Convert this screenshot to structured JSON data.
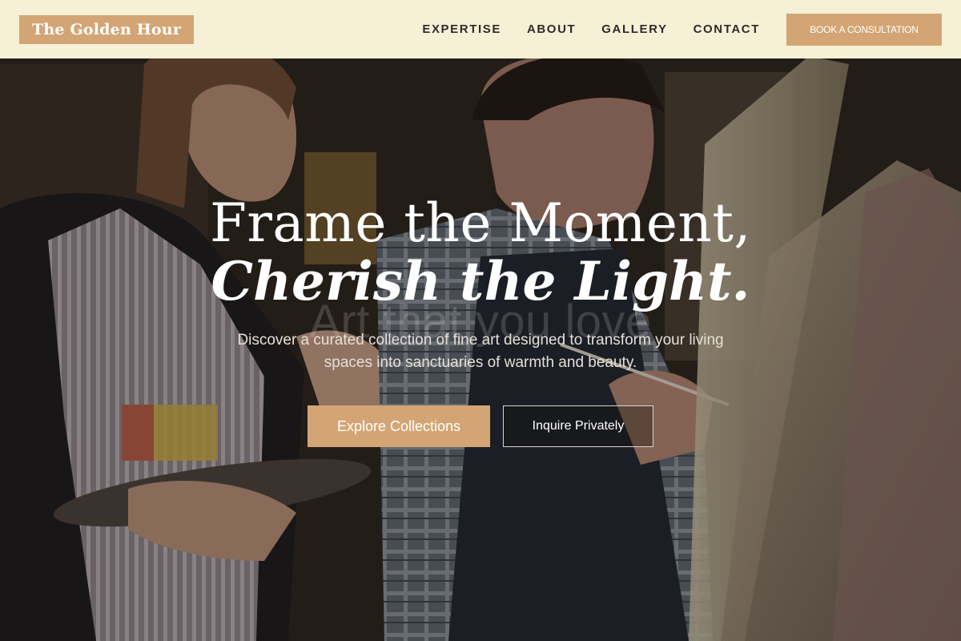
{
  "header": {
    "logo": "The Golden Hour",
    "nav": [
      "EXPERTISE",
      "ABOUT",
      "GALLERY",
      "CONTACT"
    ],
    "cta": "BOOK A CONSULTATION"
  },
  "hero": {
    "headline_line1": "Frame the Moment,",
    "headline_line2": "Cherish the Light.",
    "ghost_text": "Art that you love",
    "subtitle": "Discover a curated collection of fine art designed to transform your living spaces into sanctuaries of warmth and beauty.",
    "primary_button": "Explore Collections",
    "secondary_button": "Inquire Privately"
  },
  "colors": {
    "accent": "#d4a574",
    "header_bg": "#f6f1d6",
    "nav_text": "#2d2b2a",
    "hero_text": "#ffffff"
  }
}
